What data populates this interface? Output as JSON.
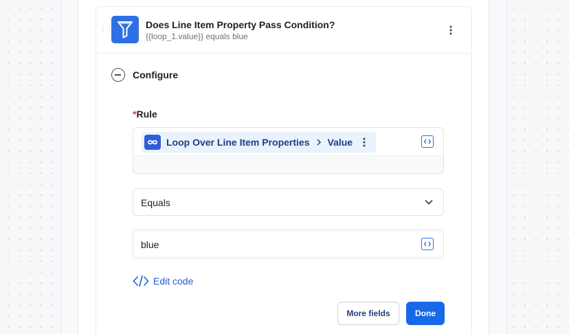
{
  "step": {
    "title": "Does Line Item Property Pass Condition?",
    "subtitle": "{{loop_1.value}} equals blue",
    "icon": "filter-icon",
    "icon_color": "#2f6fe4"
  },
  "configure": {
    "label": "Configure"
  },
  "rule": {
    "required_mark": "*",
    "label": "Rule",
    "token": {
      "icon": "loop-icon",
      "source": "Loop Over Line Item Properties",
      "field": "Value"
    }
  },
  "operator": {
    "selected": "Equals"
  },
  "value": {
    "text": "blue"
  },
  "edit_code": {
    "label": "Edit code"
  },
  "buttons": {
    "more_fields": "More fields",
    "done": "Done"
  },
  "colors": {
    "accent": "#1769e8",
    "required": "#d63b3b",
    "token_bg": "#eaf2fd"
  }
}
